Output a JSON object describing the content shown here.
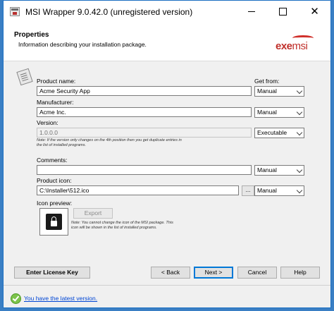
{
  "window": {
    "title": "MSI Wrapper 9.0.42.0 (unregistered version)",
    "controls": [
      "minimize",
      "maximize",
      "close"
    ]
  },
  "header": {
    "title": "Properties",
    "subtitle": "Information describing your installation package.",
    "logo_text_a": "exe",
    "logo_text_b": "msi"
  },
  "form": {
    "get_from_label": "Get from:",
    "product_name": {
      "label": "Product name:",
      "value": "Acme Security App",
      "source": "Manual"
    },
    "manufacturer": {
      "label": "Manufacturer:",
      "value": "Acme Inc.",
      "source": "Manual"
    },
    "version": {
      "label": "Version:",
      "value": "1.0.0.0",
      "source": "Executable",
      "note_line1": "Note: If the version only changes on the 4th position then you get duplicate entries in",
      "note_line2": "the list of installed programs."
    },
    "comments": {
      "label": "Comments:",
      "value": "",
      "source": "Manual"
    },
    "product_icon": {
      "label": "Product icon:",
      "value": "C:\\Installer\\512.ico",
      "source": "Manual",
      "browse_label": "..."
    },
    "icon_preview": {
      "label": "Icon preview:",
      "export_label": "Export",
      "note_line1": "Note: You cannot change the icon of the MSI package. This",
      "note_line2": "icon will be shown in the list of installed programs."
    }
  },
  "buttons": {
    "license": "Enter License Key",
    "back": "< Back",
    "next": "Next >",
    "cancel": "Cancel",
    "help": "Help"
  },
  "status": {
    "message": "You have the latest version."
  },
  "colors": {
    "window_border": "#1c6fc2",
    "brand_red": "#c0302b",
    "focus_blue": "#0078d7",
    "link": "#0046d5"
  }
}
